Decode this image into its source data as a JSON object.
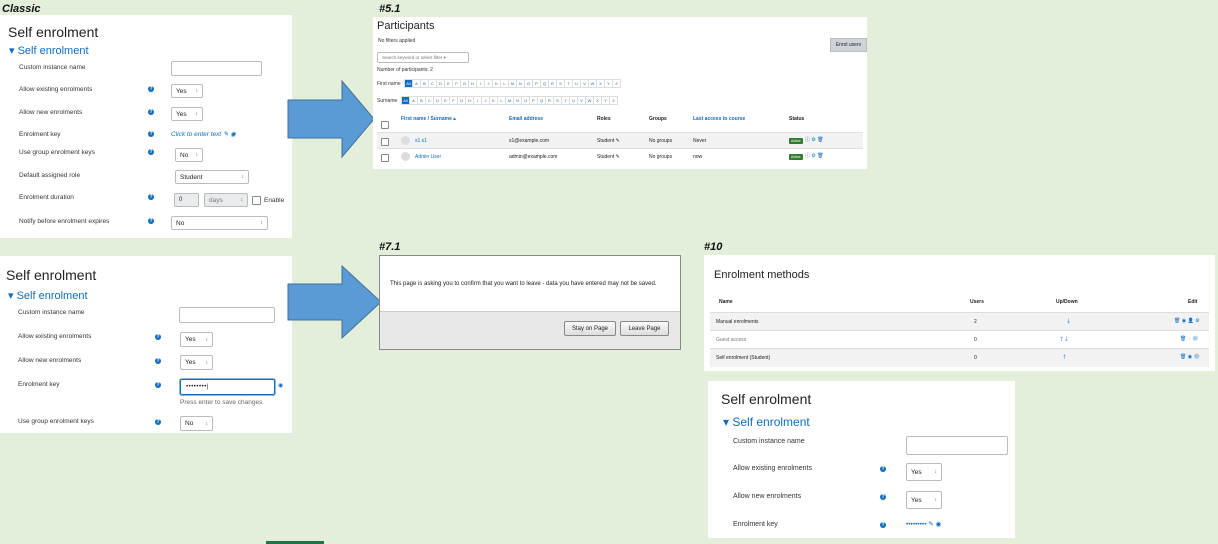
{
  "captions": {
    "classic": "Classic",
    "p51": "#5.1",
    "p71": "#7.1",
    "p10": "#10"
  },
  "form_classic": {
    "title": "Self enrolment",
    "section": "Self enrolment",
    "labels": [
      "Custom instance name",
      "Allow existing enrolments",
      "Allow new enrolments",
      "Enrolment key",
      "Use group enrolment keys",
      "Default assigned role",
      "Enrolment duration",
      "Notify before enrolment expires"
    ],
    "yes": "Yes",
    "no": "No",
    "enrolment_key_link": "Click to enter text",
    "role": "Student",
    "duration_value": "0",
    "duration_unit": "days",
    "enable": "Enable"
  },
  "form_51": {
    "title": "Self enrolment",
    "section": "Self enrolment",
    "labels": [
      "Custom instance name",
      "Allow existing enrolments",
      "Allow new enrolments",
      "Enrolment key",
      "Use group enrolment keys"
    ],
    "yes": "Yes",
    "no": "No",
    "key_mask": "••••••••|",
    "key_hint": "Press enter to save changes"
  },
  "form_10": {
    "title": "Self enrolment",
    "section": "Self enrolment",
    "labels": [
      "Custom instance name",
      "Allow existing enrolments",
      "Allow new enrolments",
      "Enrolment key"
    ],
    "yes": "Yes",
    "key_mask": "•••••••••"
  },
  "participants": {
    "title": "Participants",
    "no_filters": "No filters applied",
    "enrol_button": "Enrol users",
    "search_placeholder": "Search keyword or select filter",
    "count": "Number of participants: 2",
    "first_name": "First name",
    "surname": "Surname",
    "letters": [
      "All",
      "A",
      "B",
      "C",
      "D",
      "E",
      "F",
      "G",
      "H",
      "I",
      "J",
      "K",
      "L",
      "M",
      "N",
      "O",
      "P",
      "Q",
      "R",
      "S",
      "T",
      "U",
      "V",
      "W",
      "X",
      "Y",
      "Z"
    ],
    "headers": [
      "First name / Surname",
      "Email address",
      "Roles",
      "Groups",
      "Last access to course",
      "Status"
    ],
    "rows": [
      {
        "name": "s1 s1",
        "email": "s1@example.com",
        "role": "Student",
        "groups": "No groups",
        "access": "Never",
        "status": "Active"
      },
      {
        "name": "Admin User",
        "email": "admin@example.com",
        "role": "Student",
        "groups": "No groups",
        "access": "now",
        "status": "Active"
      }
    ]
  },
  "dialog": {
    "message": "This page is asking you to confirm that you want to leave - data you have entered may not be saved.",
    "stay": "Stay on Page",
    "leave": "Leave Page"
  },
  "methods": {
    "title": "Enrolment methods",
    "headers": [
      "Name",
      "Users",
      "Up/Down",
      "Edit"
    ],
    "rows": [
      {
        "name": "Manual enrolments",
        "users": "2"
      },
      {
        "name": "Guest access",
        "users": "0"
      },
      {
        "name": "Self enrolment (Student)",
        "users": "0"
      }
    ]
  },
  "colors": {
    "accent": "#0f6cbf",
    "arrow": "#5b9bd5",
    "active": "#357a32",
    "background": "#e3efda"
  }
}
